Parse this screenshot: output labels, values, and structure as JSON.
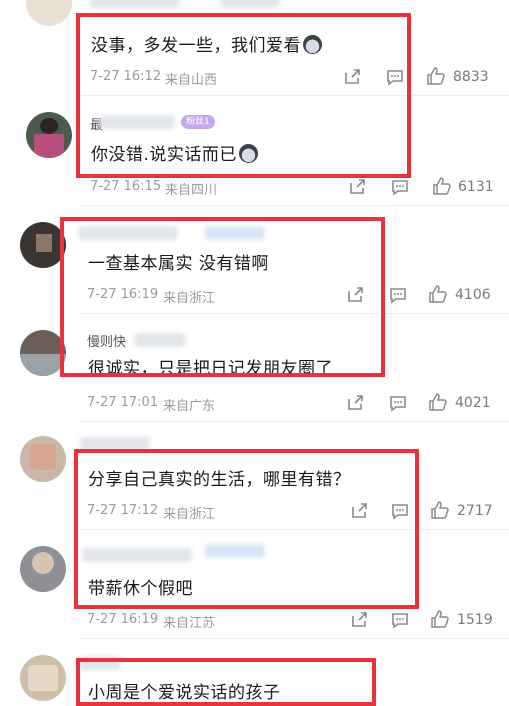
{
  "comments": [
    {
      "id": "c1",
      "text": "没事，多发一些，我们爱看",
      "time": "7-27 16:12",
      "location": "来自山西",
      "likes": "8833"
    },
    {
      "id": "c2",
      "name": "最",
      "badge": "粉丝1",
      "text": "你没错.说实话而已",
      "time": "7-27 16:15",
      "location": "来自四川",
      "likes": "6131"
    },
    {
      "id": "c3",
      "text": "一查基本属实 没有错啊",
      "time": "7-27 16:19",
      "location": "来自浙江",
      "likes": "4106"
    },
    {
      "id": "c4",
      "name": "慢则快",
      "text": "很诚实，只是把日记发朋友圈了",
      "time": "7-27 17:01",
      "location": "来自广东",
      "likes": "4021"
    },
    {
      "id": "c5",
      "text": "分享自己真实的生活，哪里有错？",
      "time": "7-27 17:12",
      "location": "来自浙江",
      "likes": "2717"
    },
    {
      "id": "c6",
      "text": "带薪休个假吧",
      "time": "7-27 16:19",
      "location": "来自江苏",
      "likes": "1519"
    },
    {
      "id": "c7",
      "text": "小周是个爱说实话的孩子"
    }
  ],
  "icons": {
    "share": "share-icon",
    "reply": "comment-icon",
    "like": "thumbs-up-icon"
  },
  "colors": {
    "highlight_box": "#e8323c",
    "meta_text": "#9a9a9a",
    "badge": "#c7a6f0"
  }
}
